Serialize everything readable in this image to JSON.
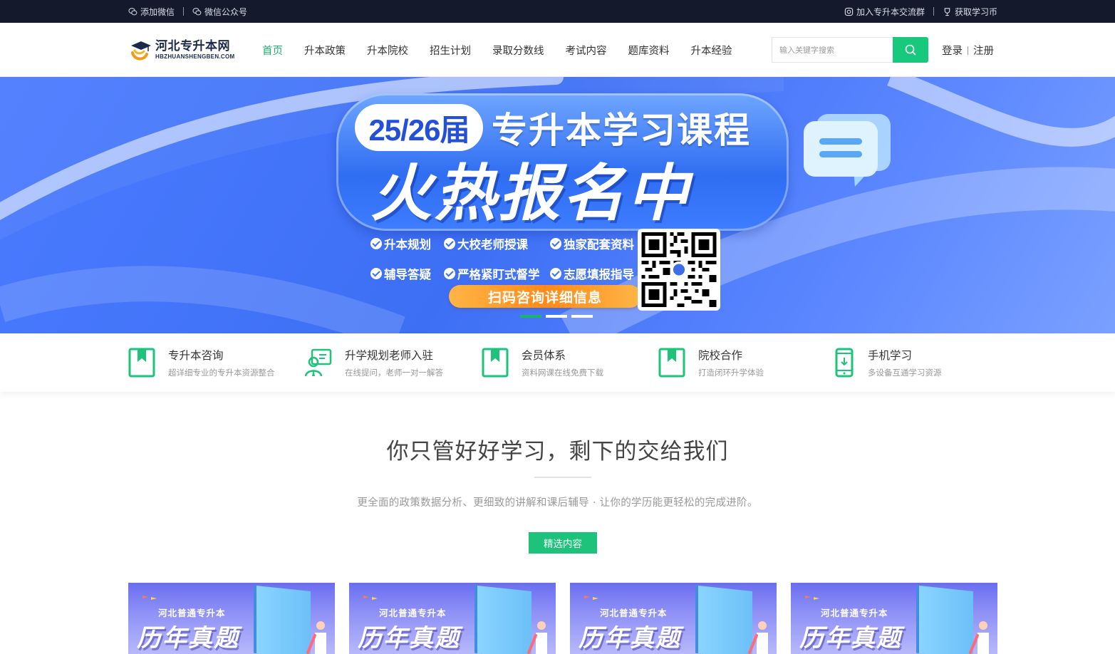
{
  "topbar": {
    "left_items": [
      {
        "label": "添加微信",
        "icon": "wechat-icon"
      },
      {
        "label": "微信公众号",
        "icon": "wechat-official-icon"
      }
    ],
    "right_items": [
      {
        "label": "加入专升本交流群",
        "icon": "instagram-icon"
      },
      {
        "label": "获取学习币",
        "icon": "trophy-icon"
      }
    ]
  },
  "header": {
    "logo": {
      "cn": "河北专升本网",
      "en": "HBZHUANSHENGBEN.COM"
    },
    "nav": [
      "首页",
      "升本政策",
      "升本院校",
      "招生计划",
      "录取分数线",
      "考试内容",
      "题库资料",
      "升本经验"
    ],
    "active_nav": 0,
    "search": {
      "placeholder": "输入关键字搜索",
      "icon": "search-icon"
    },
    "auth": {
      "login": "登录",
      "register": "注册"
    }
  },
  "banner": {
    "year": "25/26届",
    "title": "专升本学习课程",
    "headline": "火热报名中",
    "features": [
      "升本规划",
      "大校老师授课",
      "独家配套资料",
      "辅导答疑",
      "严格紧盯式督学",
      "志愿填报指导"
    ],
    "cta": "扫码咨询详细信息",
    "qr_icon": "qr-code-icon",
    "slides": 3,
    "active_slide": 0
  },
  "services": [
    {
      "title": "专升本咨询",
      "sub": "超详细专业的专升本资源整合",
      "icon": "bookmark-icon"
    },
    {
      "title": "升学规划老师入驻",
      "sub": "在线提问，老师一对一解答",
      "icon": "teacher-icon"
    },
    {
      "title": "会员体系",
      "sub": "资料网课在线免费下载",
      "icon": "bookmark-icon"
    },
    {
      "title": "院校合作",
      "sub": "打造闭环升学体验",
      "icon": "bookmark-icon"
    },
    {
      "title": "手机学习",
      "sub": "多设备互通学习资源",
      "icon": "mobile-icon"
    }
  ],
  "section": {
    "title": "你只管好好学习，剩下的交给我们",
    "sub": "更全面的政策数据分析、更细致的讲解和课后辅导 · 让你的学历能更轻松的完成进阶。",
    "button": "精选内容"
  },
  "cards": [
    {
      "label": "河北普通专升本",
      "big": "历年真题"
    },
    {
      "label": "河北普通专升本",
      "big": "历年真题"
    },
    {
      "label": "河北普通专升本",
      "big": "历年真题"
    },
    {
      "label": "河北普通专升本",
      "big": "历年真题"
    }
  ],
  "colors": {
    "accent": "#1dc37a",
    "topbar": "#141a2b",
    "banner": "#3d6ff5",
    "cta": "#ff9a2a"
  }
}
